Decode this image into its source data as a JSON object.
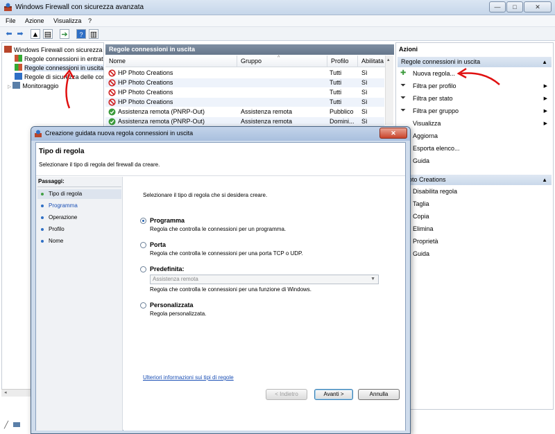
{
  "window": {
    "title": "Windows Firewall con sicurezza avanzata",
    "controls": {
      "minimize": "—",
      "maximize": "□",
      "close": "✕"
    }
  },
  "menu": {
    "file": "File",
    "azione": "Azione",
    "visualizza": "Visualizza",
    "help": "?"
  },
  "tree": {
    "root": "Windows Firewall con sicurezza",
    "items": [
      "Regole connessioni in entrata",
      "Regole connessioni in uscita",
      "Regole di sicurezza delle connessioni",
      "Monitoraggio"
    ]
  },
  "list": {
    "header": "Regole connessioni in uscita",
    "columns": {
      "nome": "Nome",
      "gruppo": "Gruppo",
      "profilo": "Profilo",
      "abilitata": "Abilitata"
    },
    "rows": [
      {
        "nome": "HP Photo Creations",
        "gruppo": "",
        "profilo": "Tutti",
        "abilitata": "Sì",
        "status": "blocked"
      },
      {
        "nome": "HP Photo Creations",
        "gruppo": "",
        "profilo": "Tutti",
        "abilitata": "Sì",
        "status": "blocked"
      },
      {
        "nome": "HP Photo Creations",
        "gruppo": "",
        "profilo": "Tutti",
        "abilitata": "Sì",
        "status": "blocked"
      },
      {
        "nome": "HP Photo Creations",
        "gruppo": "",
        "profilo": "Tutti",
        "abilitata": "Sì",
        "status": "blocked"
      },
      {
        "nome": "Assistenza remota (PNRP-Out)",
        "gruppo": "Assistenza remota",
        "profilo": "Pubblico",
        "abilitata": "Sì",
        "status": "allowed"
      },
      {
        "nome": "Assistenza remota (PNRP-Out)",
        "gruppo": "Assistenza remota",
        "profilo": "Domini...",
        "abilitata": "Sì",
        "status": "allowed"
      }
    ]
  },
  "actions": {
    "title": "Azioni",
    "section1": "Regole connessioni in uscita",
    "items1": [
      "Nuova regola...",
      "Filtra per profilo",
      "Filtra per stato",
      "Filtra per gruppo",
      "Visualizza",
      "Aggiorna",
      "Esporta elenco...",
      "Guida"
    ],
    "section2": "Photo Creations",
    "items2": [
      "Disabilita regola",
      "Taglia",
      "Copia",
      "Elimina",
      "Proprietà",
      "Guida"
    ]
  },
  "dialog": {
    "title": "Creazione guidata nuova regola connessioni in uscita",
    "close": "✕",
    "heading": "Tipo di regola",
    "subheading": "Selezionare il tipo di regola del firewall da creare.",
    "steps_header": "Passaggi:",
    "steps": [
      "Tipo di regola",
      "Programma",
      "Operazione",
      "Profilo",
      "Nome"
    ],
    "intro": "Selezionare il tipo di regola che si desidera creare.",
    "options": [
      {
        "label": "Programma",
        "desc": "Regola che controlla le connessioni per un programma.",
        "selected": true
      },
      {
        "label": "Porta",
        "desc": "Regola che controlla le connessioni per una porta TCP o UDP.",
        "selected": false
      },
      {
        "label": "Predefinita:",
        "desc": "Regola che controlla le connessioni per una funzione di Windows.",
        "selected": false,
        "dropdown": "Assistenza remota"
      },
      {
        "label": "Personalizzata",
        "desc": "Regola personalizzata.",
        "selected": false
      }
    ],
    "link": "Ulteriori informazioni sui tipi di regole",
    "buttons": {
      "back": "< Indietro",
      "next": "Avanti >",
      "cancel": "Annulla"
    }
  },
  "colors": {
    "accent": "#1f5fb0",
    "list_header": "#6f8095",
    "annotation": "#e01010"
  }
}
